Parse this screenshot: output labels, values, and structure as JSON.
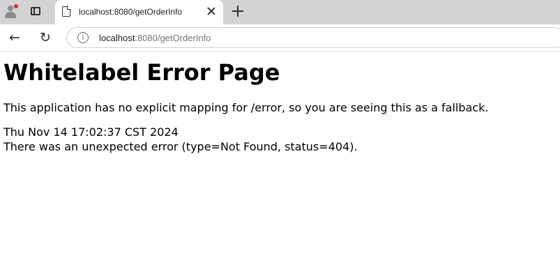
{
  "browser": {
    "tab": {
      "title": "localhost:8080/getOrderInfo"
    },
    "address_bar": {
      "host": "localhost",
      "path": ":8080/getOrderInfo"
    },
    "icons": [
      "profile-icon",
      "tab-actions-icon",
      "page-icon",
      "close-icon",
      "new-tab-icon",
      "back-icon",
      "reload-icon",
      "site-info-icon"
    ]
  },
  "page": {
    "heading": "Whitelabel Error Page",
    "message": "This application has no explicit mapping for /error, so you are seeing this as a fallback.",
    "timestamp": "Thu Nov 14 17:02:37 CST 2024",
    "error": "There was an unexpected error (type=Not Found, status=404)."
  }
}
